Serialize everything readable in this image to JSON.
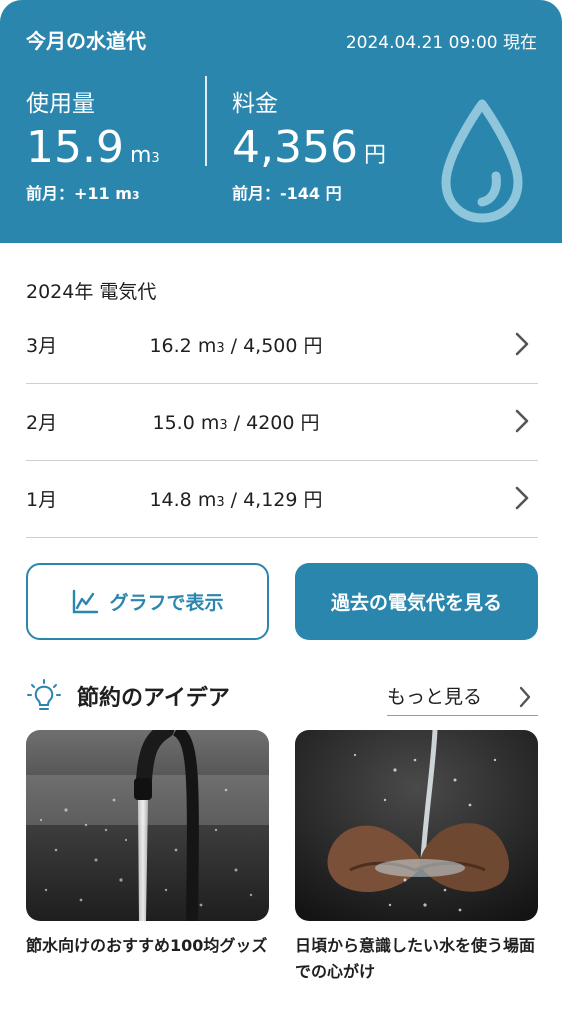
{
  "header": {
    "title": "今月の水道代",
    "timestamp": "2024.04.21 09:00 現在",
    "usage": {
      "label": "使用量",
      "value": "15.9",
      "unit": "m",
      "unit_sup": "3",
      "prev_label": "前月：+11 m",
      "prev_sup": "3"
    },
    "fee": {
      "label": "料金",
      "value": "4,356",
      "unit": "円",
      "prev": "前月：-144 円"
    },
    "icon": "water-drop-icon"
  },
  "history": {
    "title": "2024年 電気代",
    "rows": [
      {
        "month": "3月",
        "usage": "16.2 m",
        "sup": "3",
        "fee": " / 4,500 円"
      },
      {
        "month": "2月",
        "usage": "15.0 m",
        "sup": "3",
        "fee": " / 4200 円"
      },
      {
        "month": "1月",
        "usage": "14.8 m",
        "sup": "3",
        "fee": " / 4,129 円"
      }
    ]
  },
  "buttons": {
    "graph": "グラフで表示",
    "graph_icon": "line-chart-icon",
    "past": "過去の電気代を見る"
  },
  "tips": {
    "title": "節約のアイデア",
    "icon": "lightbulb-icon",
    "more": "もっと見る",
    "cards": [
      {
        "caption": "節水向けのおすすめ100均グッズ"
      },
      {
        "caption": "日頃から意識したい水を使う場面での心がけ"
      }
    ]
  },
  "colors": {
    "accent": "#2b86ad",
    "divider": "#cfcfcf"
  }
}
